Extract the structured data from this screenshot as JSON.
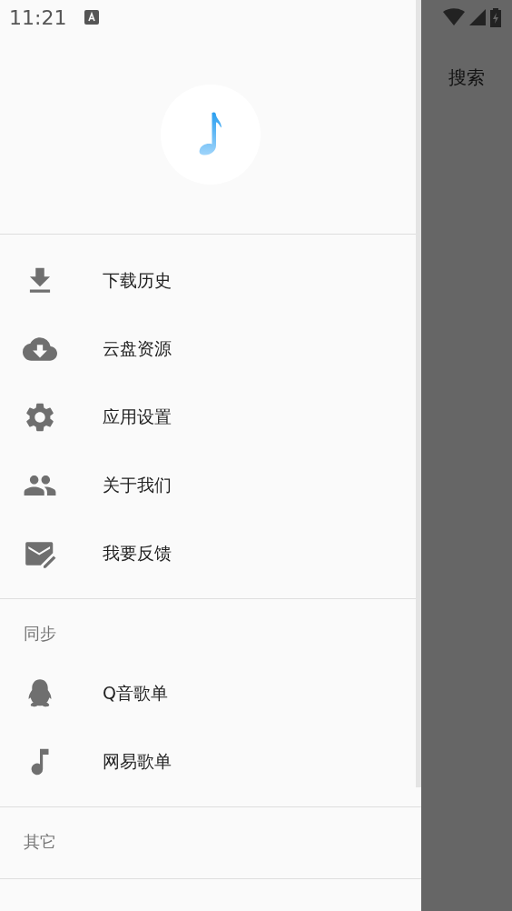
{
  "status_bar": {
    "time": "11:21"
  },
  "drawer": {
    "sections": [
      {
        "items": [
          {
            "label": "下载历史"
          },
          {
            "label": "云盘资源"
          },
          {
            "label": "应用设置"
          },
          {
            "label": "关于我们"
          },
          {
            "label": "我要反馈"
          }
        ]
      },
      {
        "header": "同步",
        "items": [
          {
            "label": "Q音歌单"
          },
          {
            "label": "网易歌单"
          }
        ]
      },
      {
        "header": "其它"
      }
    ]
  },
  "background": {
    "toolbar_action": "搜索"
  }
}
